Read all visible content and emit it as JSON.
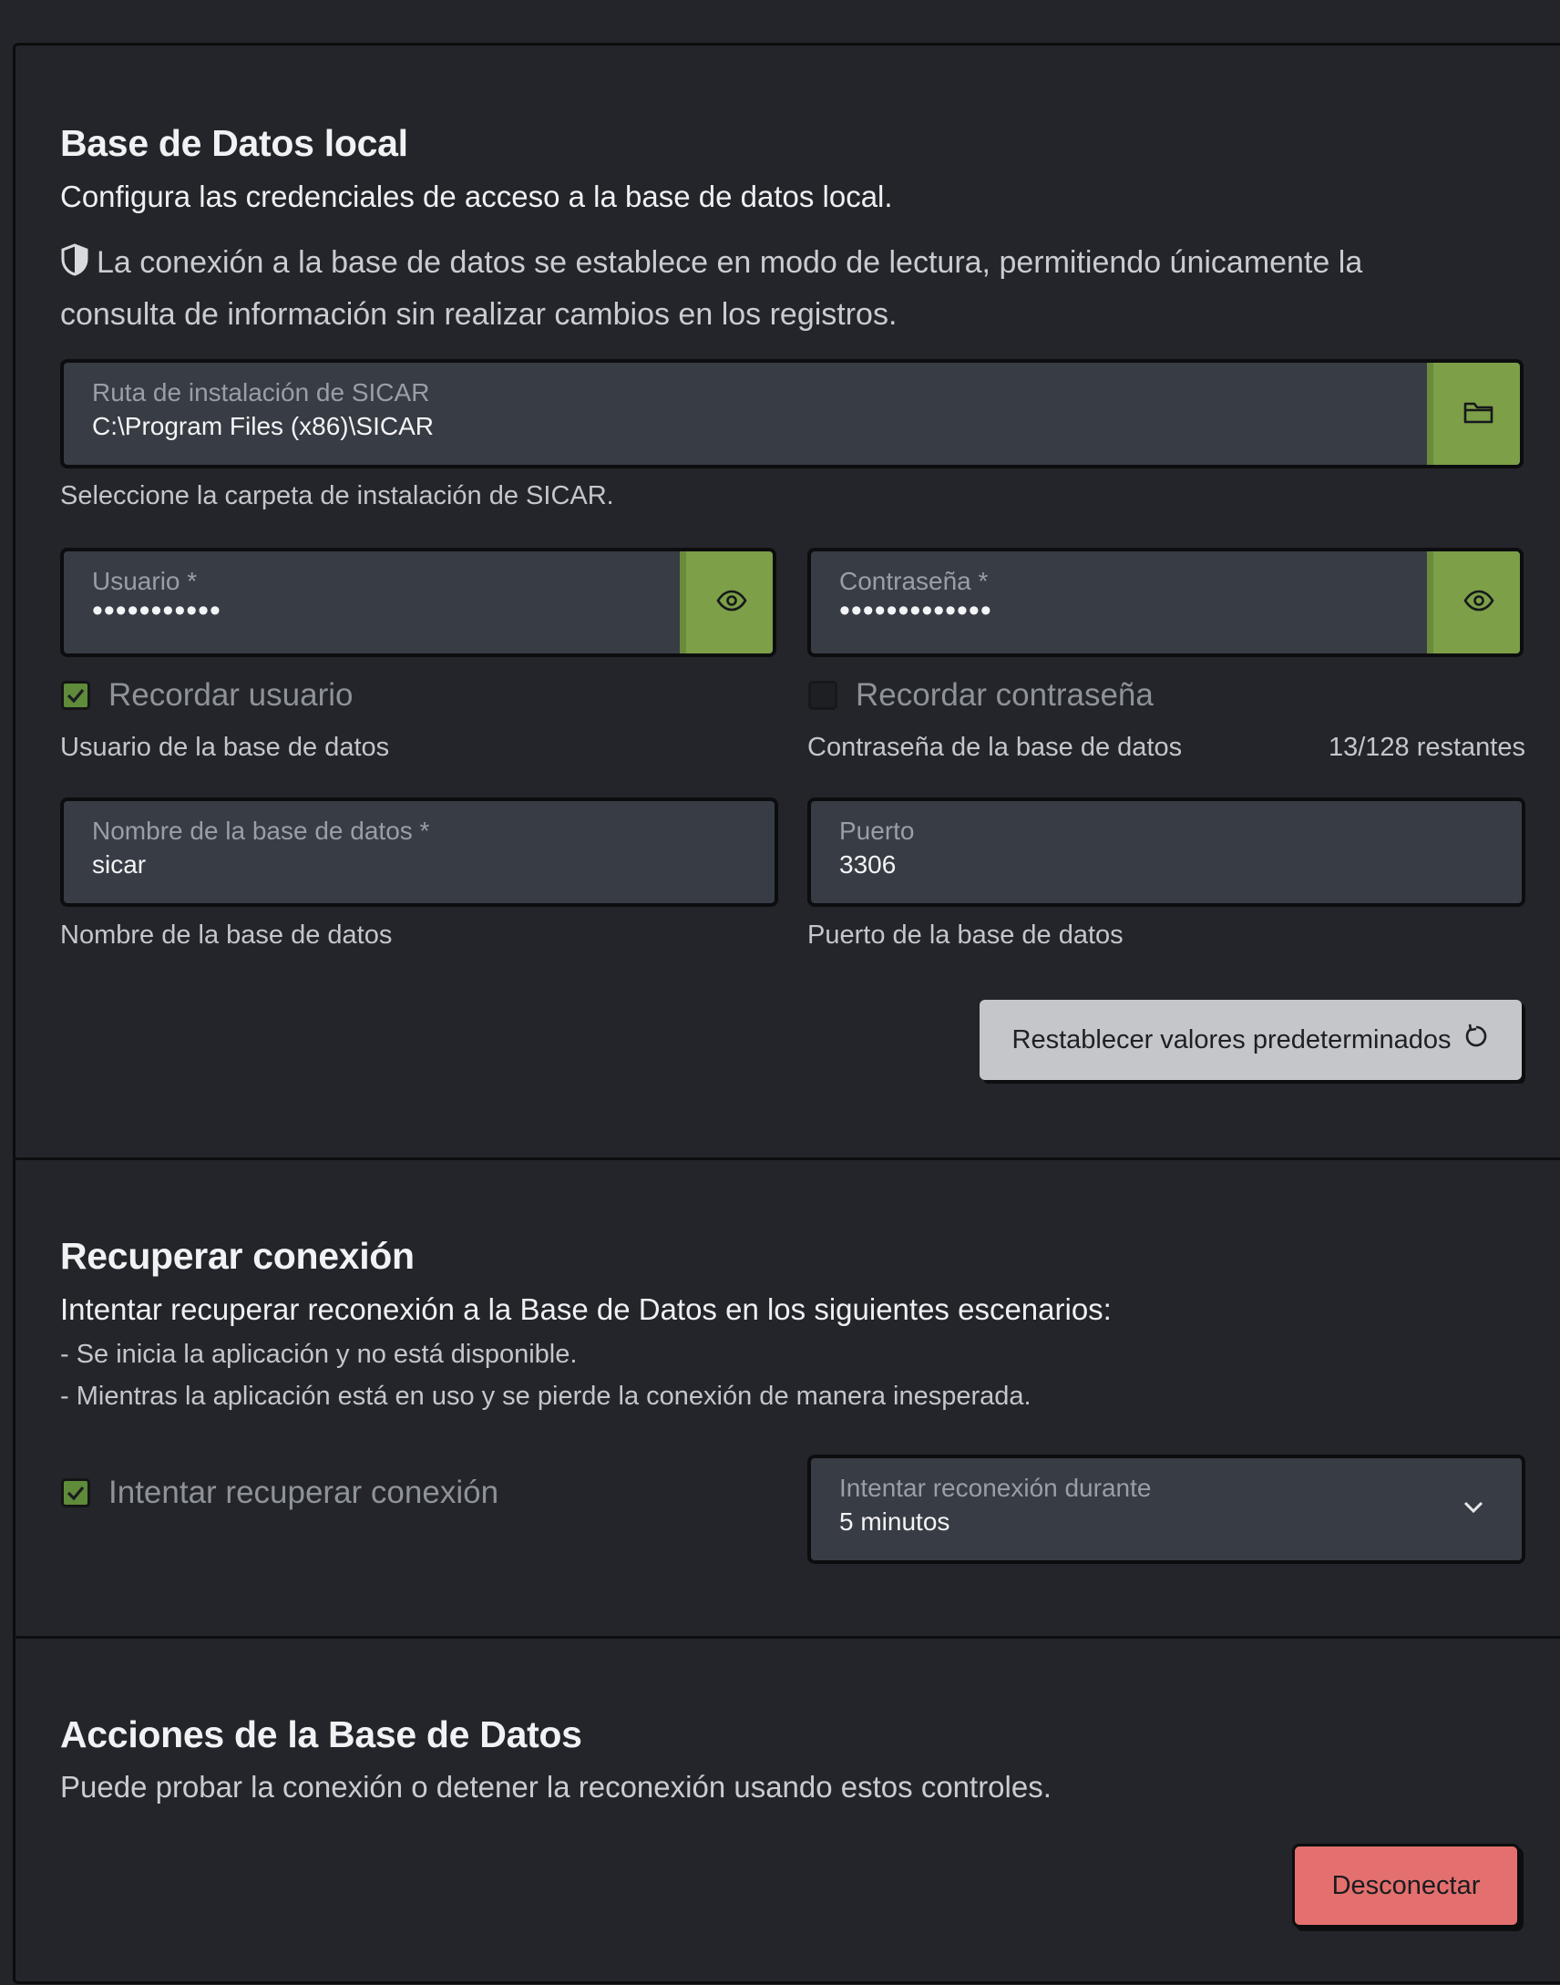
{
  "db_local": {
    "title": "Base de Datos local",
    "subtitle": "Configura las credenciales de acceso a la base de datos local.",
    "notice_line1": "La conexión a la base de datos se establece en modo de lectura, permitiendo únicamente la",
    "notice_line2": "consulta de información sin realizar cambios en los registros.",
    "path_field": {
      "label": "Ruta de instalación de SICAR",
      "value": "C:\\Program Files (x86)\\SICAR",
      "hint": "Seleccione la carpeta de instalación de SICAR."
    },
    "user_field": {
      "label": "Usuario *",
      "masked_value": "•••••••••••",
      "remember_label": "Recordar usuario",
      "remember_checked": true,
      "hint": "Usuario de la base de datos"
    },
    "password_field": {
      "label": "Contraseña *",
      "masked_value": "•••••••••••••",
      "remember_label": "Recordar contraseña",
      "remember_checked": false,
      "hint": "Contraseña de la base de datos",
      "counter": "13/128 restantes"
    },
    "dbname_field": {
      "label": "Nombre de la base de datos *",
      "value": "sicar",
      "hint": "Nombre de la base de datos"
    },
    "port_field": {
      "label": "Puerto",
      "value": "3306",
      "hint": "Puerto de la base de datos"
    },
    "reset_button": "Restablecer valores predeterminados"
  },
  "recover": {
    "title": "Recuperar conexión",
    "subtitle": "Intentar recuperar reconexión a la Base de Datos en los siguientes escenarios:",
    "bullet1": "- Se inicia la aplicación y no está disponible.",
    "bullet2": "- Mientras la aplicación está en uso y se pierde la conexión de manera inesperada.",
    "checkbox_label": "Intentar recuperar conexión",
    "checkbox_checked": true,
    "duration_select": {
      "label": "Intentar reconexión durante",
      "value": "5 minutos"
    }
  },
  "actions": {
    "title": "Acciones de la Base de Datos",
    "subtitle": "Puede probar la conexión o detener la reconexión usando estos controles.",
    "disconnect_button": "Desconectar"
  },
  "colors": {
    "accent_green": "#7c9f48",
    "danger": "#e3706e",
    "background": "#23252a",
    "field_bg": "#383c44"
  }
}
